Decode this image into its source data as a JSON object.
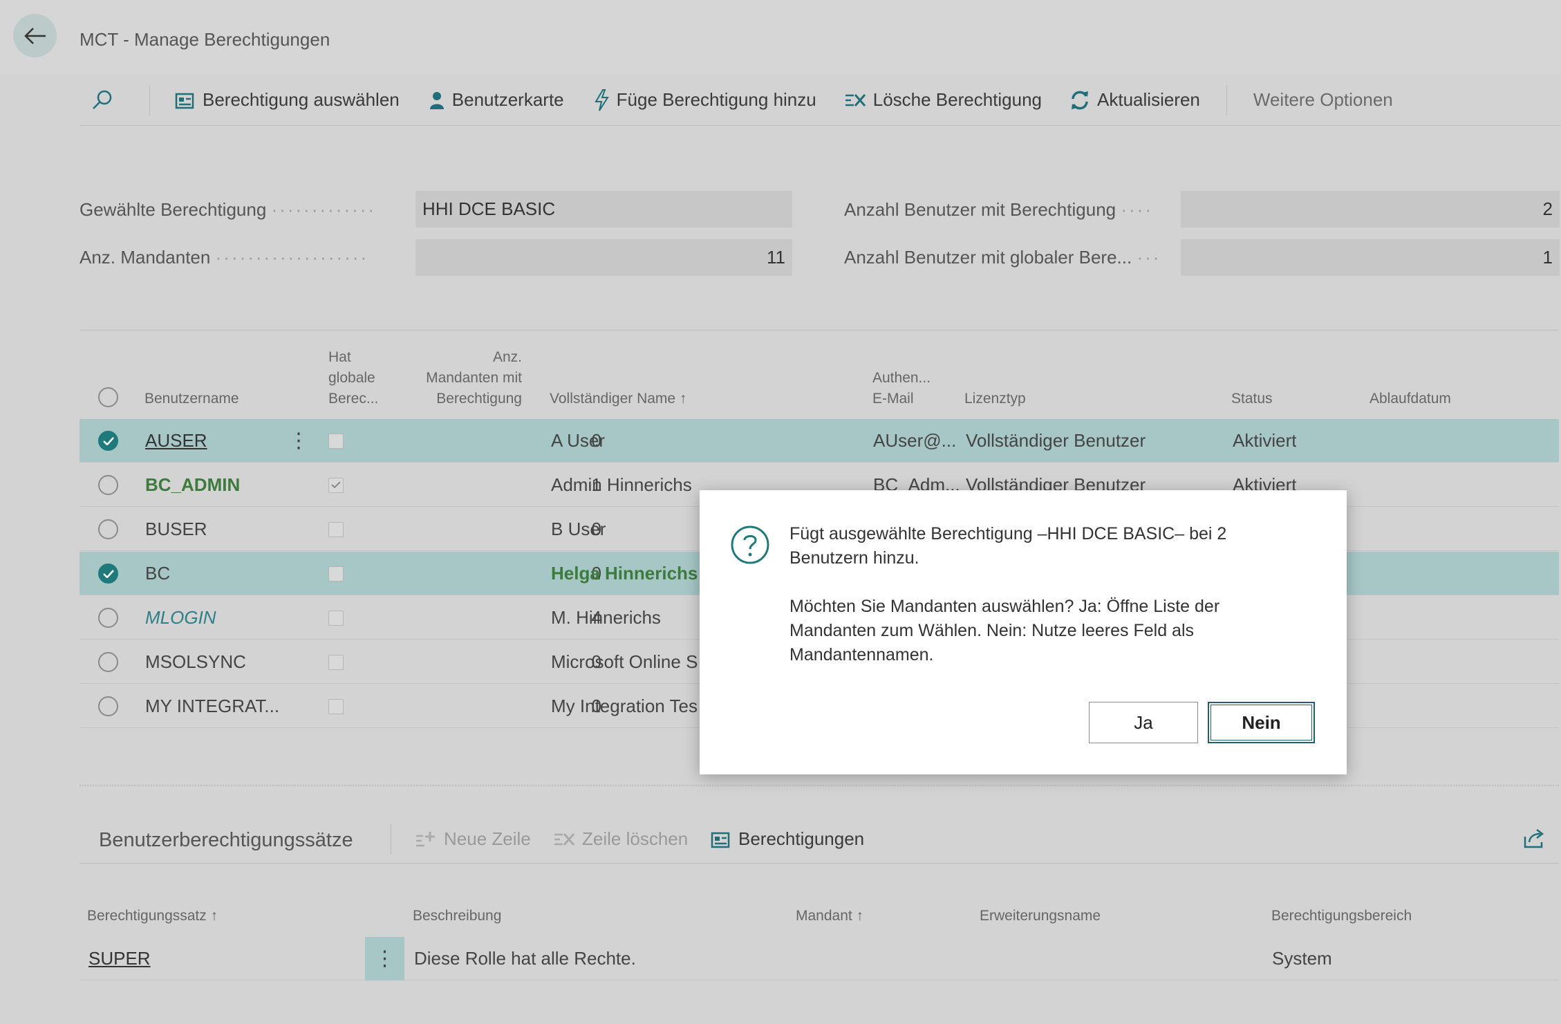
{
  "window": {
    "title": "MCT - Manage Berechtigungen"
  },
  "toolbar": {
    "items": [
      {
        "label": "Berechtigung auswählen"
      },
      {
        "label": "Benutzerkarte"
      },
      {
        "label": "Füge Berechtigung hinzu"
      },
      {
        "label": "Lösche Berechtigung"
      },
      {
        "label": "Aktualisieren"
      }
    ],
    "more": "Weitere Optionen"
  },
  "fields": {
    "selected_permission": {
      "label": "Gewählte Berechtigung",
      "value": "HHI DCE BASIC"
    },
    "company_count": {
      "label": "Anz. Mandanten",
      "value": "11"
    },
    "users_with_permission": {
      "label": "Anzahl Benutzer mit Berechtigung",
      "value": "2"
    },
    "users_with_global": {
      "label": "Anzahl Benutzer mit globaler Bere...",
      "value": "1"
    }
  },
  "grid": {
    "headers": {
      "username": "Benutzername",
      "global_l1": "Hat",
      "global_l2": "globale",
      "global_l3": "Berec...",
      "count_l1": "Anz.",
      "count_l2": "Mandanten mit",
      "count_l3": "Berechtigung",
      "fullname": "Vollständiger Name ↑",
      "auth_l1": "Authen...",
      "auth_l2": "E-Mail",
      "license": "Lizenztyp",
      "status": "Status",
      "expiry": "Ablaufdatum"
    },
    "rows": [
      {
        "username": "AUSER",
        "count": "0",
        "fullname": "A User",
        "email": "AUser@...",
        "license": "Vollständiger Benutzer",
        "status": "Aktiviert"
      },
      {
        "username": "BC_ADMIN",
        "count": "1",
        "fullname": "Admin Hinnerichs",
        "email": "BC_Adm...",
        "license": "Vollständiger Benutzer",
        "status": "Aktiviert"
      },
      {
        "username": "BUSER",
        "count": "0",
        "fullname": "B User"
      },
      {
        "username": "BC",
        "count": "0",
        "fullname": "Helga Hinnerichs"
      },
      {
        "username": "MLOGIN",
        "count": "4",
        "fullname": "M. Hinnerichs"
      },
      {
        "username": "MSOLSYNC",
        "count": "0",
        "fullname": "Microsoft Online S"
      },
      {
        "username": "MY INTEGRAT...",
        "count": "0",
        "fullname": "My Integration Tes"
      }
    ]
  },
  "subpage": {
    "title": "Benutzerberechtigungssätze",
    "actions": {
      "new_line": "Neue Zeile",
      "delete_line": "Zeile löschen",
      "permissions": "Berechtigungen"
    },
    "headers": {
      "set": "Berechtigungssatz ↑",
      "description": "Beschreibung",
      "company": "Mandant ↑",
      "extension": "Erweiterungsname",
      "scope": "Berechtigungsbereich"
    },
    "rows": [
      {
        "set": "SUPER",
        "description": "Diese Rolle hat alle Rechte.",
        "scope": "System"
      }
    ]
  },
  "dialog": {
    "line1": "Fügt ausgewählte Berechtigung –HHI DCE BASIC– bei 2",
    "line2": "Benutzern hinzu.",
    "line3": "Möchten Sie Mandanten auswählen? Ja: Öffne Liste der",
    "line4": "Mandanten zum Wählen. Nein: Nutze leeres Feld als",
    "line5": "Mandantennamen.",
    "yes": "Ja",
    "no": "Nein"
  },
  "colors": {
    "accent": "#1f7b7b",
    "selected_row": "#a7c7c7",
    "green_user": "#3d7a3d"
  }
}
